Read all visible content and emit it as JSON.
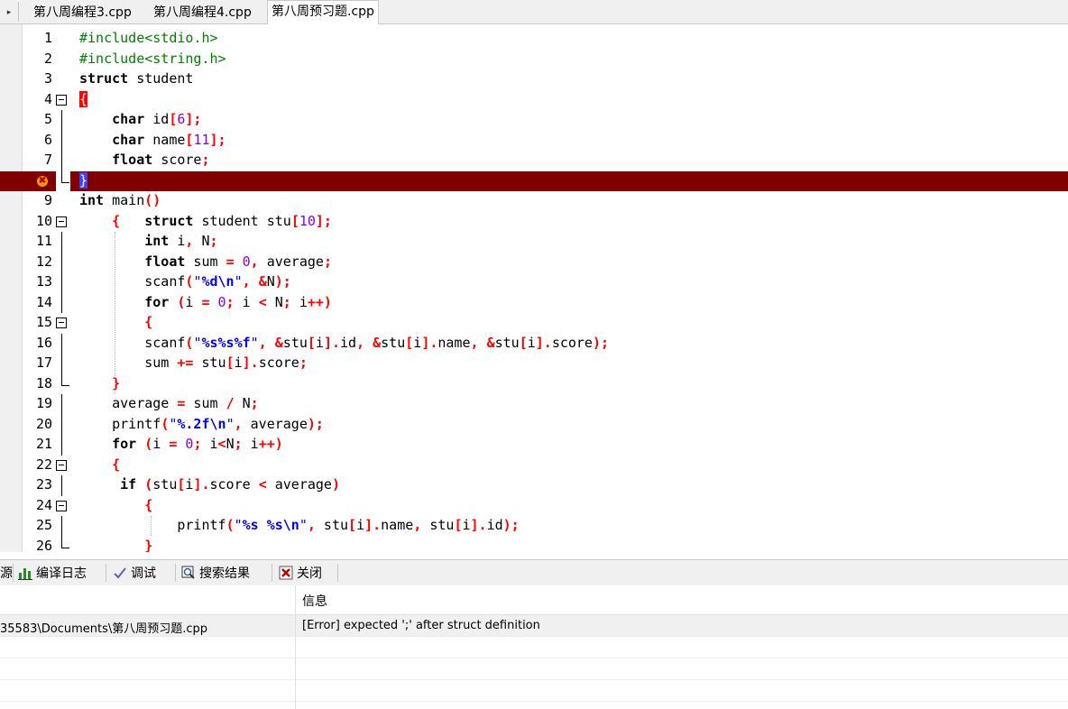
{
  "tabs": [
    {
      "label": "第八周编程3.cpp",
      "active": false
    },
    {
      "label": "第八周编程4.cpp",
      "active": false
    },
    {
      "label": "第八周预习题.cpp",
      "active": true
    }
  ],
  "editor": {
    "line_numbers": [
      "1",
      "2",
      "3",
      "4",
      "5",
      "6",
      "7",
      "8",
      "9",
      "10",
      "11",
      "12",
      "13",
      "14",
      "15",
      "16",
      "17",
      "18",
      "19",
      "20",
      "21",
      "22",
      "23",
      "24",
      "25",
      "26"
    ],
    "error_line": "8",
    "colors": {
      "error_line_bg": "#800000",
      "preprocessor": "#008000",
      "operator": "#ff0000",
      "number": "#8000ff",
      "string": "#0000ff"
    }
  },
  "bottom_tabs": [
    {
      "label": "编译日志",
      "icon": "bar-chart-icon"
    },
    {
      "label": "调试",
      "icon": "check-icon"
    },
    {
      "label": "搜索结果",
      "icon": "search-icon"
    },
    {
      "label": "关闭",
      "icon": "close-icon"
    }
  ],
  "bottom_tab_partial": "源",
  "messages": {
    "header_info": "信息",
    "rows": [
      {
        "file": "35583\\Documents\\第八周预习题.cpp",
        "text": "[Error] expected ';' after struct definition"
      }
    ]
  }
}
